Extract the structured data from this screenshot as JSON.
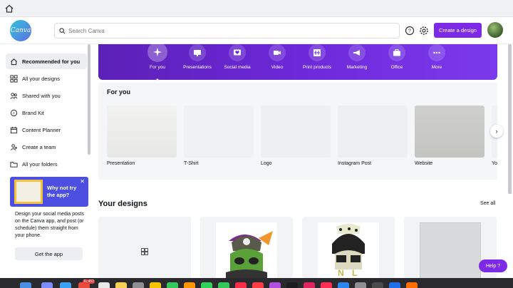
{
  "search": {
    "placeholder": "Search Canva"
  },
  "header": {
    "create_label": "Create a design",
    "logo_text": "Canva"
  },
  "sidebar": {
    "items": [
      {
        "label": "Recommended for you",
        "icon": "recommended-icon"
      },
      {
        "label": "All your designs",
        "icon": "grid-icon"
      },
      {
        "label": "Shared with you",
        "icon": "people-icon"
      },
      {
        "label": "Brand Kit",
        "icon": "brand-kit-icon"
      },
      {
        "label": "Content Planner",
        "icon": "calendar-icon"
      },
      {
        "label": "Create a team",
        "icon": "team-icon"
      },
      {
        "label": "All your folders",
        "icon": "folder-icon"
      }
    ]
  },
  "promo": {
    "title": "Why not try the app?",
    "text": "Design your social media posts on the Canva app, and post (or schedule) them straight from your phone.",
    "button": "Get the app"
  },
  "categories": [
    {
      "label": "For you",
      "icon": "sparkle-icon"
    },
    {
      "label": "Presentations",
      "icon": "presentation-icon"
    },
    {
      "label": "Social media",
      "icon": "heart-icon"
    },
    {
      "label": "Video",
      "icon": "video-icon"
    },
    {
      "label": "Print products",
      "icon": "print-icon"
    },
    {
      "label": "Marketing",
      "icon": "megaphone-icon"
    },
    {
      "label": "Office",
      "icon": "briefcase-icon"
    },
    {
      "label": "More",
      "icon": "more-icon"
    }
  ],
  "for_you": {
    "title": "For you",
    "cards": [
      "Presentation",
      "T-Shirt",
      "Logo",
      "Instagram Post",
      "Website",
      "Yo"
    ]
  },
  "designs": {
    "title": "Your designs",
    "see_all": "See all"
  },
  "help": {
    "label": "Help ?"
  },
  "dock": {
    "badge": "11,452"
  },
  "colors": {
    "accent": "#7d2ae8",
    "hero": "#6d28d9"
  }
}
